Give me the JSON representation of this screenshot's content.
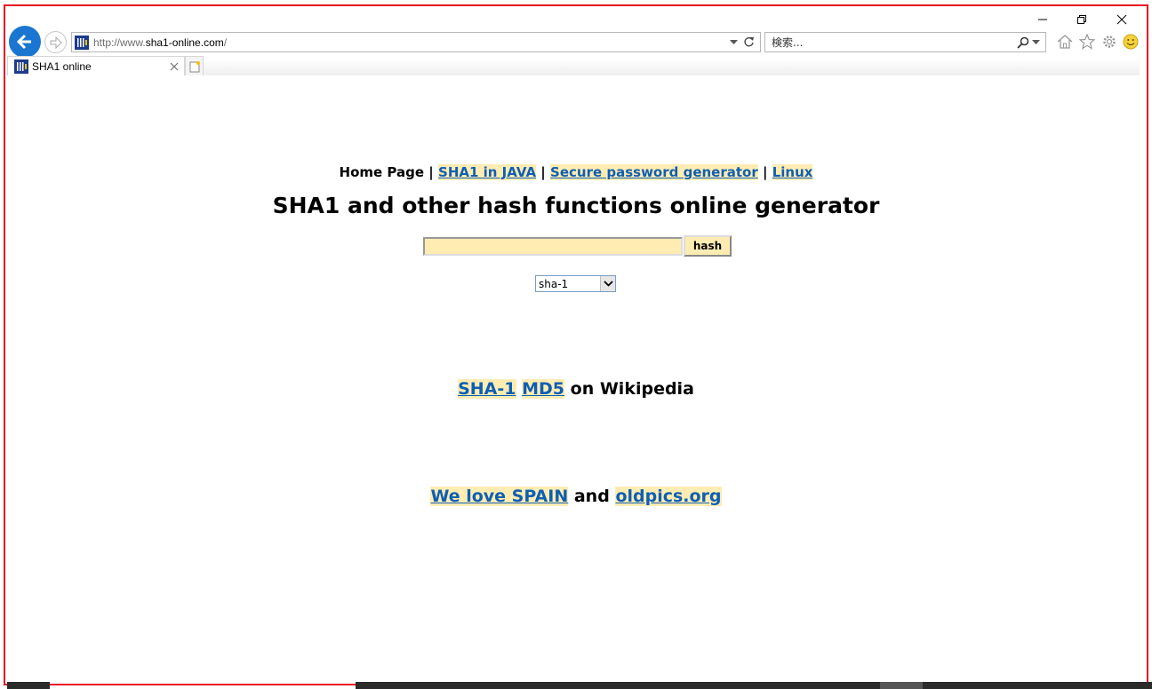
{
  "browser": {
    "address_url_prefix": "http://www.",
    "address_url_host": "sha1-online.com",
    "address_url_suffix": "/",
    "search_placeholder": "検索...",
    "tab_title": "SHA1 online"
  },
  "page": {
    "nav": {
      "home": "Home Page",
      "sep": "|",
      "java": "SHA1 in JAVA",
      "password": "Secure password generator",
      "linux": "Linux"
    },
    "heading": "SHA1 and other hash functions online generator",
    "hash_input_value": "",
    "hash_button": "hash",
    "algorithm_selected": "sha-1",
    "wiki": {
      "sha1": "SHA-1",
      "md5": "MD5",
      "suffix": "on Wikipedia"
    },
    "footer": {
      "spain": "We love SPAIN",
      "and": "and",
      "oldpics": "oldpics.org"
    }
  },
  "colors": {
    "window_border": "#e81123",
    "link_highlight": "#ffecb3",
    "link_text": "#0e5fb3",
    "back_button": "#1b76d2"
  }
}
